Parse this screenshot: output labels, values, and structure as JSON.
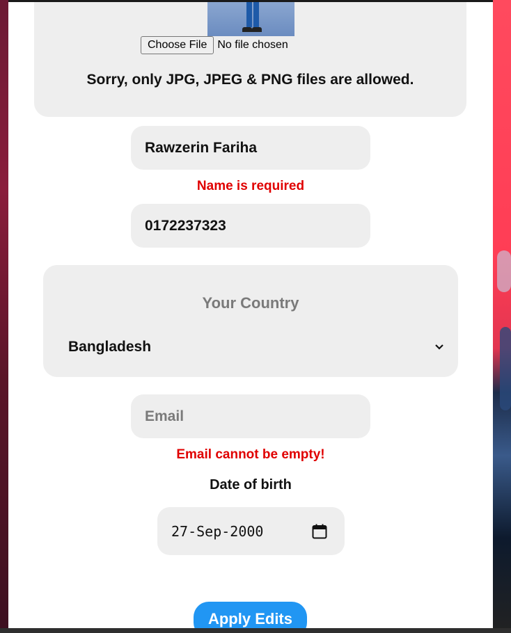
{
  "profile_form": {
    "file_upload": {
      "choose_button_label": "Choose File",
      "status_text": "No file chosen",
      "error_text": "Sorry, only JPG, JPEG & PNG files are allowed."
    },
    "name_field": {
      "value": "Rawzerin Fariha",
      "error_text": "Name is required"
    },
    "phone_field": {
      "value": "0172237323"
    },
    "country_field": {
      "label": "Your Country",
      "selected": "Bangladesh"
    },
    "email_field": {
      "placeholder": "Email",
      "error_text": "Email cannot be empty!"
    },
    "dob_field": {
      "label": "Date of birth",
      "value": "27-Sep-2000"
    },
    "apply_button_label": "Apply Edits"
  },
  "colors": {
    "field_bg": "#eeeeee",
    "error": "#e00000",
    "primary_button": "#2196f3"
  },
  "icons": {
    "select_chevron": "chevron-down-icon",
    "date_picker": "calendar-icon"
  }
}
